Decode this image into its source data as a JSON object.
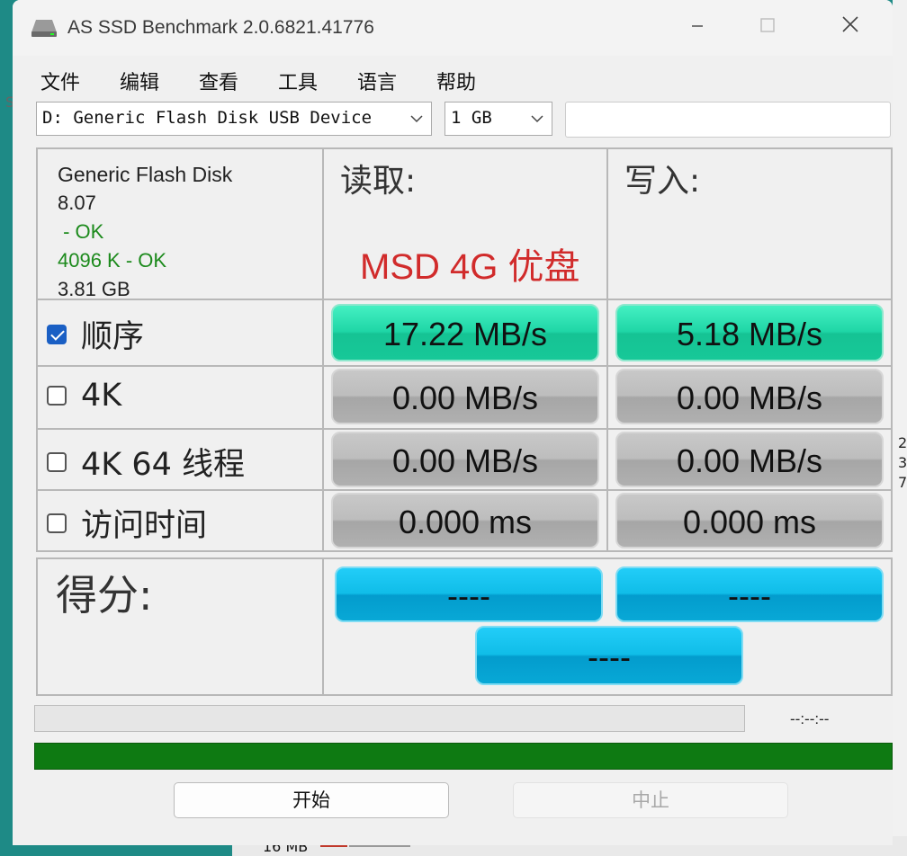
{
  "window": {
    "title": "AS SSD Benchmark 2.0.6821.41776"
  },
  "menu": [
    "文件",
    "编辑",
    "查看",
    "工具",
    "语言",
    "帮助"
  ],
  "drive_select": {
    "value": "D: Generic Flash Disk USB Device"
  },
  "size_select": {
    "value": "1 GB"
  },
  "disk_info": {
    "name": "Generic Flash Disk",
    "firmware": "8.07",
    "driver_status": " - OK",
    "alignment": "4096 K - OK",
    "capacity": "3.81 GB"
  },
  "headers": {
    "read": "读取:",
    "write": "写入:"
  },
  "overlay_label": "MSD 4G 优盘",
  "tests": [
    {
      "label": "顺序",
      "checked": true,
      "read": "17.22 MB/s",
      "write": "5.18 MB/s"
    },
    {
      "label": "4K",
      "checked": false,
      "read": "0.00 MB/s",
      "write": "0.00 MB/s"
    },
    {
      "label": "4K 64 线程",
      "checked": false,
      "read": "0.00 MB/s",
      "write": "0.00 MB/s"
    },
    {
      "label": "访问时间",
      "checked": false,
      "read": "0.000 ms",
      "write": "0.000 ms"
    }
  ],
  "score": {
    "label": "得分:",
    "read": "----",
    "write": "----",
    "total": "----"
  },
  "progress": {
    "time": "--:--:--",
    "fraction": 0
  },
  "buttons": {
    "start": "开始",
    "stop": "中止"
  },
  "background": {
    "bottom_text": "16 MB",
    "side_text": [
      "2",
      "3",
      "7"
    ],
    "left_text": "S"
  },
  "colors": {
    "result_green": "#1fd6a6",
    "result_gray": "#b4b4b4",
    "score_blue": "#10bde8",
    "status_green": "#0e7a12",
    "overlay_red": "#d12b2b"
  }
}
